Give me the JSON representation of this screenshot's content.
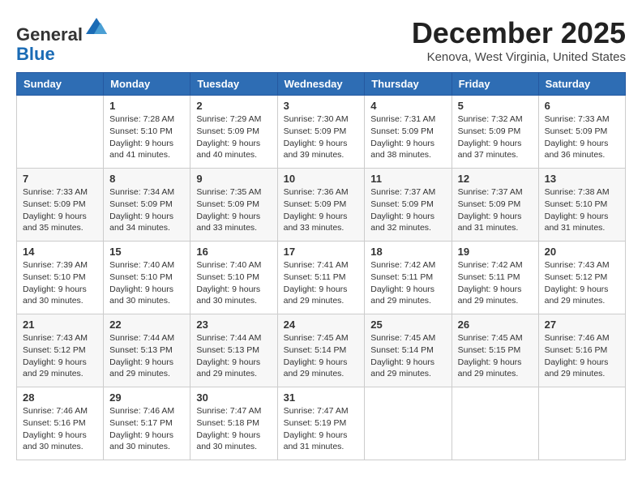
{
  "header": {
    "logo_line1": "General",
    "logo_line2": "Blue",
    "month_title": "December 2025",
    "location": "Kenova, West Virginia, United States"
  },
  "days_of_week": [
    "Sunday",
    "Monday",
    "Tuesday",
    "Wednesday",
    "Thursday",
    "Friday",
    "Saturday"
  ],
  "weeks": [
    [
      {
        "day": "",
        "info": ""
      },
      {
        "day": "1",
        "info": "Sunrise: 7:28 AM\nSunset: 5:10 PM\nDaylight: 9 hours\nand 41 minutes."
      },
      {
        "day": "2",
        "info": "Sunrise: 7:29 AM\nSunset: 5:09 PM\nDaylight: 9 hours\nand 40 minutes."
      },
      {
        "day": "3",
        "info": "Sunrise: 7:30 AM\nSunset: 5:09 PM\nDaylight: 9 hours\nand 39 minutes."
      },
      {
        "day": "4",
        "info": "Sunrise: 7:31 AM\nSunset: 5:09 PM\nDaylight: 9 hours\nand 38 minutes."
      },
      {
        "day": "5",
        "info": "Sunrise: 7:32 AM\nSunset: 5:09 PM\nDaylight: 9 hours\nand 37 minutes."
      },
      {
        "day": "6",
        "info": "Sunrise: 7:33 AM\nSunset: 5:09 PM\nDaylight: 9 hours\nand 36 minutes."
      }
    ],
    [
      {
        "day": "7",
        "info": "Sunrise: 7:33 AM\nSunset: 5:09 PM\nDaylight: 9 hours\nand 35 minutes."
      },
      {
        "day": "8",
        "info": "Sunrise: 7:34 AM\nSunset: 5:09 PM\nDaylight: 9 hours\nand 34 minutes."
      },
      {
        "day": "9",
        "info": "Sunrise: 7:35 AM\nSunset: 5:09 PM\nDaylight: 9 hours\nand 33 minutes."
      },
      {
        "day": "10",
        "info": "Sunrise: 7:36 AM\nSunset: 5:09 PM\nDaylight: 9 hours\nand 33 minutes."
      },
      {
        "day": "11",
        "info": "Sunrise: 7:37 AM\nSunset: 5:09 PM\nDaylight: 9 hours\nand 32 minutes."
      },
      {
        "day": "12",
        "info": "Sunrise: 7:37 AM\nSunset: 5:09 PM\nDaylight: 9 hours\nand 31 minutes."
      },
      {
        "day": "13",
        "info": "Sunrise: 7:38 AM\nSunset: 5:10 PM\nDaylight: 9 hours\nand 31 minutes."
      }
    ],
    [
      {
        "day": "14",
        "info": "Sunrise: 7:39 AM\nSunset: 5:10 PM\nDaylight: 9 hours\nand 30 minutes."
      },
      {
        "day": "15",
        "info": "Sunrise: 7:40 AM\nSunset: 5:10 PM\nDaylight: 9 hours\nand 30 minutes."
      },
      {
        "day": "16",
        "info": "Sunrise: 7:40 AM\nSunset: 5:10 PM\nDaylight: 9 hours\nand 30 minutes."
      },
      {
        "day": "17",
        "info": "Sunrise: 7:41 AM\nSunset: 5:11 PM\nDaylight: 9 hours\nand 29 minutes."
      },
      {
        "day": "18",
        "info": "Sunrise: 7:42 AM\nSunset: 5:11 PM\nDaylight: 9 hours\nand 29 minutes."
      },
      {
        "day": "19",
        "info": "Sunrise: 7:42 AM\nSunset: 5:11 PM\nDaylight: 9 hours\nand 29 minutes."
      },
      {
        "day": "20",
        "info": "Sunrise: 7:43 AM\nSunset: 5:12 PM\nDaylight: 9 hours\nand 29 minutes."
      }
    ],
    [
      {
        "day": "21",
        "info": "Sunrise: 7:43 AM\nSunset: 5:12 PM\nDaylight: 9 hours\nand 29 minutes."
      },
      {
        "day": "22",
        "info": "Sunrise: 7:44 AM\nSunset: 5:13 PM\nDaylight: 9 hours\nand 29 minutes."
      },
      {
        "day": "23",
        "info": "Sunrise: 7:44 AM\nSunset: 5:13 PM\nDaylight: 9 hours\nand 29 minutes."
      },
      {
        "day": "24",
        "info": "Sunrise: 7:45 AM\nSunset: 5:14 PM\nDaylight: 9 hours\nand 29 minutes."
      },
      {
        "day": "25",
        "info": "Sunrise: 7:45 AM\nSunset: 5:14 PM\nDaylight: 9 hours\nand 29 minutes."
      },
      {
        "day": "26",
        "info": "Sunrise: 7:45 AM\nSunset: 5:15 PM\nDaylight: 9 hours\nand 29 minutes."
      },
      {
        "day": "27",
        "info": "Sunrise: 7:46 AM\nSunset: 5:16 PM\nDaylight: 9 hours\nand 29 minutes."
      }
    ],
    [
      {
        "day": "28",
        "info": "Sunrise: 7:46 AM\nSunset: 5:16 PM\nDaylight: 9 hours\nand 30 minutes."
      },
      {
        "day": "29",
        "info": "Sunrise: 7:46 AM\nSunset: 5:17 PM\nDaylight: 9 hours\nand 30 minutes."
      },
      {
        "day": "30",
        "info": "Sunrise: 7:47 AM\nSunset: 5:18 PM\nDaylight: 9 hours\nand 30 minutes."
      },
      {
        "day": "31",
        "info": "Sunrise: 7:47 AM\nSunset: 5:19 PM\nDaylight: 9 hours\nand 31 minutes."
      },
      {
        "day": "",
        "info": ""
      },
      {
        "day": "",
        "info": ""
      },
      {
        "day": "",
        "info": ""
      }
    ]
  ]
}
